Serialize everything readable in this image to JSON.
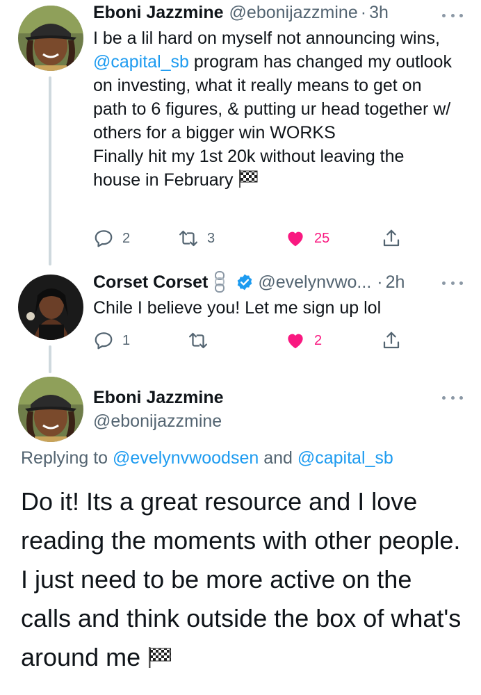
{
  "tweet1": {
    "name": "Eboni Jazzmine",
    "handle": "@ebonijazzmine",
    "separator": "·",
    "time": "3h",
    "text_part1": "I be a lil hard on myself not announcing wins,",
    "mention": "@capital_sb",
    "text_part2": "program has changed my outlook on investing, what it really means to get on path to 6 figures, & putting ur head together w/ others for a bigger win WORKS",
    "text_part3": "Finally hit my 1st 20k without leaving the house in February",
    "emoji": "checkered-flag",
    "actions": {
      "replies": "2",
      "retweets": "3",
      "likes": "25",
      "liked": true
    }
  },
  "tweet2": {
    "name": "Corset Corset",
    "handle": "@evelynvwo...",
    "separator": "·",
    "time": "2h",
    "verified": true,
    "name_emoji": "chain-icon",
    "text": "Chile I believe you! Let me sign up lol",
    "actions": {
      "replies": "1",
      "retweets": "",
      "likes": "2",
      "liked": true
    }
  },
  "main_tweet": {
    "name": "Eboni Jazzmine",
    "handle": "@ebonijazzmine",
    "replying_prefix": "Replying to",
    "replying_to_1": "@evelynvwoodsen",
    "replying_and": "and",
    "replying_to_2": "@capital_sb",
    "text": "Do it! Its a great resource and I love reading the moments with other people. I just need to be more active on the calls and think outside the box of what's around me",
    "emoji": "checkered-flag"
  },
  "colors": {
    "accent": "#1d9bf0",
    "like": "#f91880",
    "secondary_text": "#536471",
    "thread_line": "#cfd9de"
  }
}
